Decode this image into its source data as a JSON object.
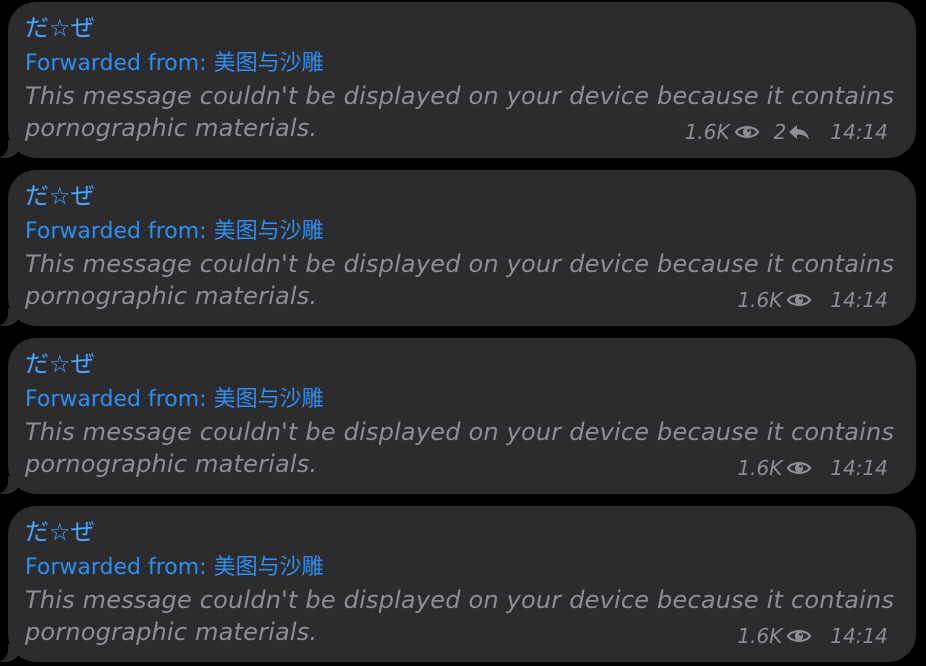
{
  "messages": [
    {
      "sender": "だ☆ぜ",
      "forwarded_from": "Forwarded from: 美图与沙雕",
      "text": "This message couldn't be displayed on your device because it contains pornographic materials.",
      "views": "1.6K",
      "replies": "2",
      "time": "14:14"
    },
    {
      "sender": "だ☆ぜ",
      "forwarded_from": "Forwarded from: 美图与沙雕",
      "text": "This message couldn't be displayed on your device because it contains pornographic materials.",
      "views": "1.6K",
      "time": "14:14"
    },
    {
      "sender": "だ☆ぜ",
      "forwarded_from": "Forwarded from: 美图与沙雕",
      "text": "This message couldn't be displayed on your device because it contains pornographic materials.",
      "views": "1.6K",
      "time": "14:14"
    },
    {
      "sender": "だ☆ぜ",
      "forwarded_from": "Forwarded from: 美图与沙雕",
      "text": "This message couldn't be displayed on your device because it contains pornographic materials.",
      "views": "1.6K",
      "time": "14:14"
    }
  ],
  "colors": {
    "background": "#000000",
    "bubble": "#2c2c2e",
    "sender": "#4aa7ff",
    "forward_link": "#2f8ef0",
    "muted_text": "#8e8e93"
  },
  "icons": {
    "views": "eye-icon",
    "replies": "reply-arrow-icon"
  }
}
